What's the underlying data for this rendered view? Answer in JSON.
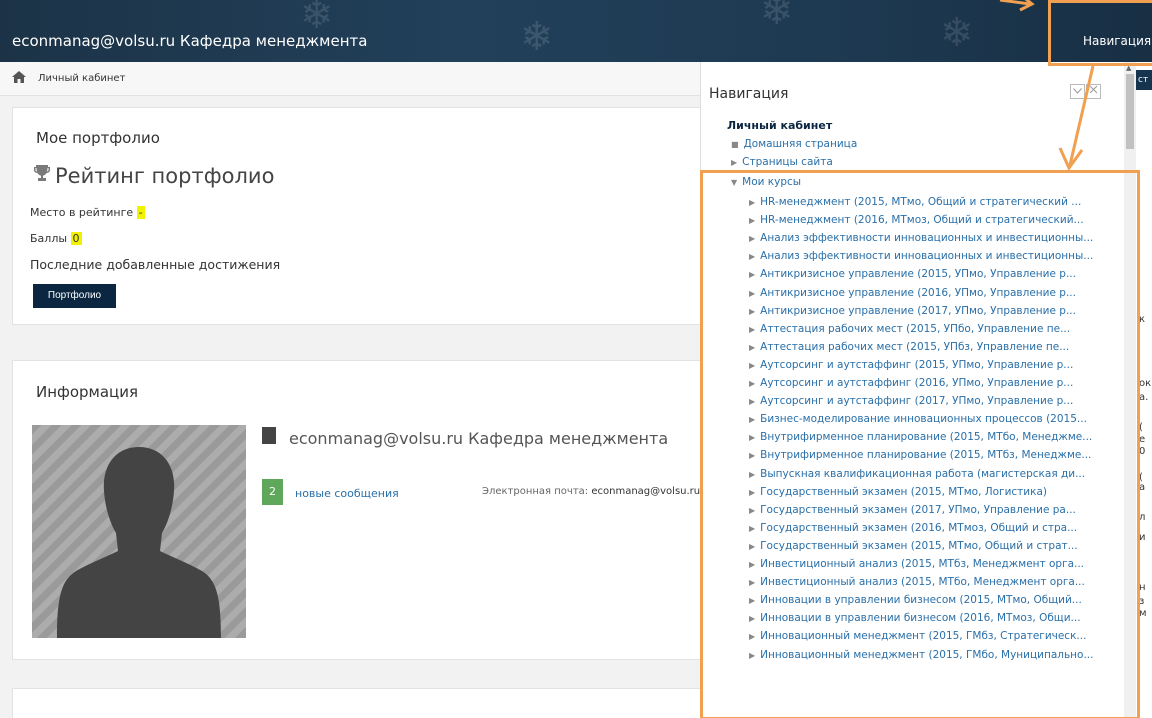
{
  "header": {
    "site_title": "econmanag@volsu.ru Кафедра менеджмента",
    "nav_button": "Навигация"
  },
  "breadcrumb": {
    "home": "Личный кабинет"
  },
  "portfolio": {
    "title": "Мое портфолио",
    "rating_title": "Рейтинг портфолио",
    "place_label": "Место в рейтинге",
    "place_value": "-",
    "points_label": "Баллы",
    "points_value": "0",
    "recent_label": "Последние добавленные достижения",
    "button_label": "Портфолио"
  },
  "info": {
    "title": "Информация",
    "user_name": "econmanag@volsu.ru Кафедра менеджмента",
    "messages_count": "2",
    "messages_label": "новые сообщения",
    "email_label": "Электронная почта:",
    "email_value": "econmanag@volsu.ru"
  },
  "right_side": {
    "tab_fragment": "ст",
    "fragments": [
      "к",
      "ок",
      "а.",
      "(",
      "е",
      "0",
      "(",
      "а",
      "л",
      "и",
      "н",
      "з",
      "м"
    ]
  },
  "navigation": {
    "title": "Навигация",
    "root": "Личный кабинет",
    "items": [
      {
        "label": "Домашняя страница"
      },
      {
        "label": "Страницы сайта"
      },
      {
        "label": "Мои курсы"
      }
    ],
    "courses": [
      "HR-менеджмент (2015, МТмо, Общий и стратегический ...",
      "HR-менеджмент (2016, МТмоз, Общий и стратегический...",
      "Анализ эффективности инновационных и инвестиционны...",
      "Анализ эффективности инновационных и инвестиционны...",
      "Антикризисное управление (2015, УПмо, Управление р...",
      "Антикризисное управление (2016, УПмо, Управление р...",
      "Антикризисное управление (2017, УПмо, Управление р...",
      "Аттестация рабочих мест (2015, УПбо, Управление пе...",
      "Аттестация рабочих мест (2015, УПбз, Управление пе...",
      "Аутсорсинг и аутстаффинг (2015, УПмо, Управление р...",
      "Аутсорсинг и аутстаффинг (2016, УПмо, Управление р...",
      "Аутсорсинг и аутстаффинг (2017, УПмо, Управление р...",
      "Бизнес-моделирование инновационных процессов (2015...",
      "Внутрифирменное планирование (2015, МТбо, Менеджме...",
      "Внутрифирменное планирование (2015, МТбз, Менеджме...",
      "Выпускная квалификационная работа (магистерская ди...",
      "Государственный экзамен (2015, МТмо, Логистика)",
      "Государственный экзамен (2017, УПмо, Управление ра...",
      "Государственный экзамен (2016, МТмоз, Общий и стра...",
      "Государственный экзамен (2015, МТмо, Общий и страт...",
      "Инвестиционный анализ (2015, МТбз, Менеджмент орга...",
      "Инвестиционный анализ (2015, МТбо, Менеджмент орга...",
      "Инновации в управлении бизнесом (2015, МТмо, Общий...",
      "Инновации в управлении бизнесом (2016, МТмоз, Общи...",
      "Инновационный менеджмент (2015, ГМбз, Стратегическ...",
      "Инновационный менеджмент (2015, ГМбо, Муниципально..."
    ]
  },
  "icons": {
    "home": "home-icon",
    "trophy": "trophy-icon",
    "user": "user-icon",
    "collapse": "collapse-icon",
    "close": "close-icon"
  },
  "colors": {
    "header_bg": "#1e3a52",
    "button_bg": "#0b2640",
    "link": "#2a6fa8",
    "highlight": "#f2f200",
    "badge": "#5fa75a",
    "annotation": "#f0a050"
  }
}
